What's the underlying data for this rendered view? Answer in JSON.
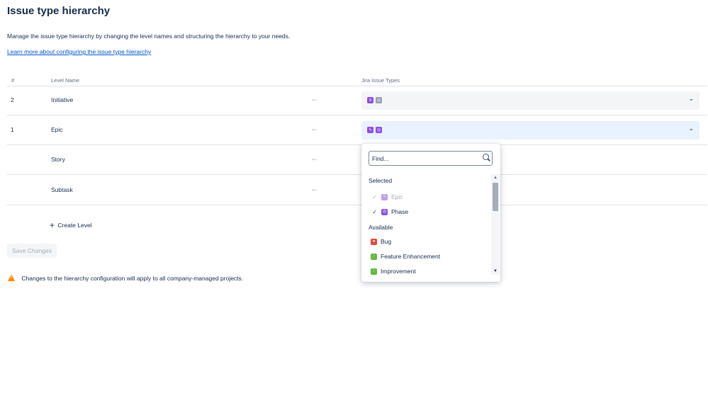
{
  "page": {
    "title": "Issue type hierarchy",
    "description": "Manage the issue type hierarchy by changing the level names and structuring the hierarchy to your needs.",
    "learn_more": "Learn more about configuring the issue type hierarchy"
  },
  "table": {
    "headers": {
      "num": "#",
      "level_name": "Level Name",
      "jira_issue_types": "Jira Issue Types"
    },
    "rows": [
      {
        "num": "2",
        "name": "Initiative",
        "icons": [
          "purple-icon",
          "grey-icon"
        ]
      },
      {
        "num": "1",
        "name": "Epic",
        "icons": [
          "epic-icon",
          "phase-icon"
        ]
      },
      {
        "num": "",
        "name": "Story"
      },
      {
        "num": "",
        "name": "Subtask"
      }
    ]
  },
  "actions": {
    "create_level": "Create Level",
    "save_changes": "Save Changes"
  },
  "warning": "Changes to the hierarchy configuration will apply to all company-managed projects.",
  "dropdown": {
    "search_placeholder": "Find...",
    "selected_label": "Selected",
    "selected": [
      {
        "label": "Epic",
        "disabled": true,
        "color": "#904ee2"
      },
      {
        "label": "Phase",
        "disabled": false,
        "color": "#904ee2"
      }
    ],
    "available_label": "Available",
    "available": [
      {
        "label": "Bug",
        "color": "#e5493a"
      },
      {
        "label": "Feature Enhancement",
        "color": "#63ba3c"
      },
      {
        "label": "Improvement",
        "color": "#63ba3c"
      }
    ]
  },
  "colors": {
    "accent": "#0052cc",
    "warning": "#ff8b00",
    "active_select_bg": "#e9f2ff"
  }
}
